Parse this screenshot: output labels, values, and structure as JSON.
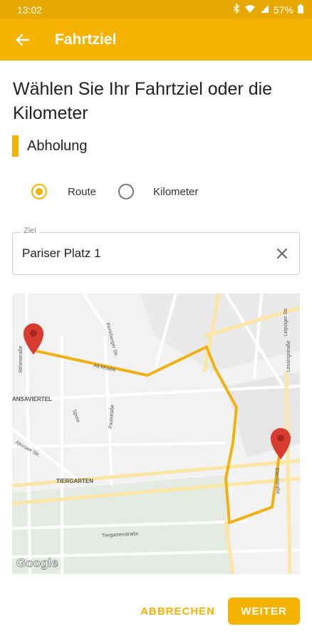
{
  "status_bar": {
    "time": "13:02",
    "battery": "57%",
    "icons": [
      "bluetooth-icon",
      "wifi-icon",
      "signal-icon",
      "battery-icon"
    ]
  },
  "app_bar": {
    "title": "Fahrtziel",
    "back_icon": "arrow-left-icon"
  },
  "heading": "Wählen Sie Ihr Fahrtziel oder die Kilometer",
  "section_label": "Abholung",
  "mode_options": [
    {
      "label": "Route",
      "selected": true
    },
    {
      "label": "Kilometer",
      "selected": false
    }
  ],
  "destination": {
    "label": "Ziel",
    "value": "Pariser Platz 1",
    "clear_icon": "close-icon"
  },
  "map": {
    "labels": {
      "area1": "ANSAVIERTEL",
      "area2": "TIERGARTEN",
      "street1": "Stromstraße",
      "street2": "Alt-Moabit",
      "street3": "Perleberger Str.",
      "street4": "Paulstraße",
      "street5": "Spree",
      "street6": "Altonaer Str.",
      "street7": "Tiergartenstraße",
      "street8": "Ebertstraße",
      "street9": "Leipziger Str.",
      "street10": "Lessingstraße"
    },
    "logo": "Google",
    "route_color": "#f0b114",
    "marker_color": "#d93b30"
  },
  "actions": {
    "cancel": "ABBRECHEN",
    "next": "WEITER"
  },
  "colors": {
    "primary": "#f5b200",
    "status": "#e7a800"
  }
}
